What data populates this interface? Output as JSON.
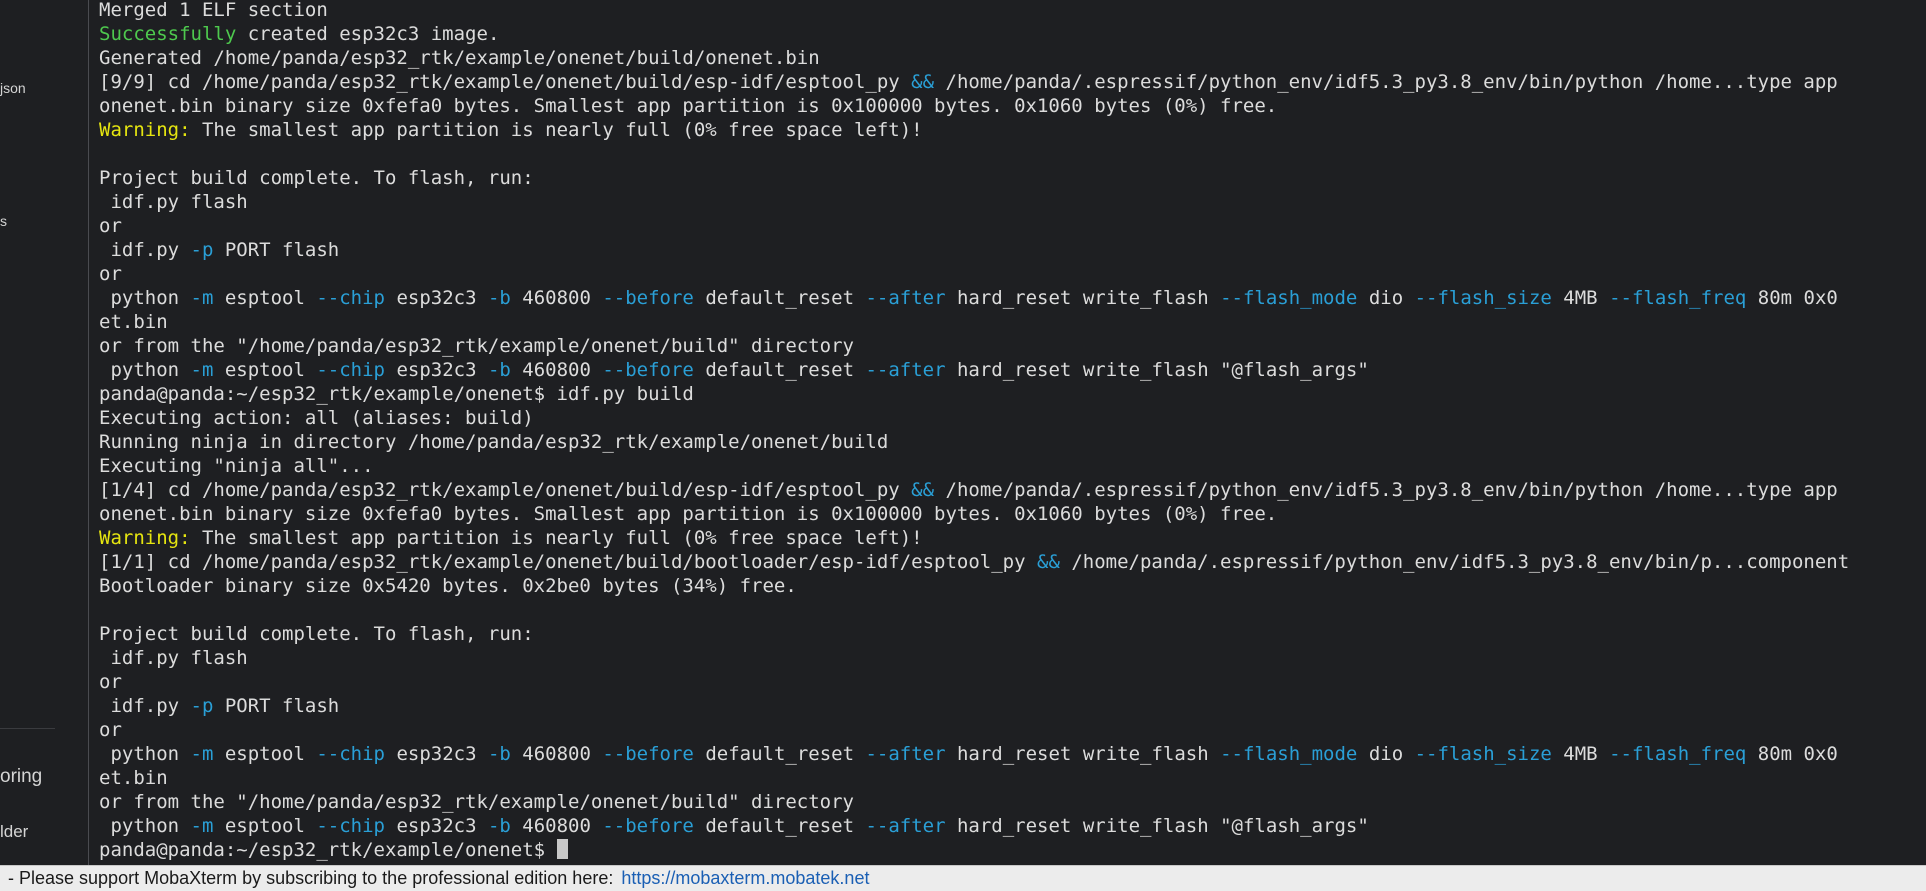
{
  "sidebar": {
    "items": [
      {
        "label": "json"
      },
      {
        "label": "s"
      },
      {
        "label": "oring"
      },
      {
        "label": "lder"
      }
    ]
  },
  "terminal": {
    "lines": [
      [
        {
          "t": "Merged 1 ELF section"
        }
      ],
      [
        {
          "t": "Successfully",
          "c": "green"
        },
        {
          "t": " created esp32c3 image."
        }
      ],
      [
        {
          "t": "Generated /home/panda/esp32_rtk/example/onenet/build/onenet.bin"
        }
      ],
      [
        {
          "t": "[9/9] cd /home/panda/esp32_rtk/example/onenet/build/esp-idf/esptool_py "
        },
        {
          "t": "&&",
          "c": "blue"
        },
        {
          "t": " /home/panda/.espressif/python_env/idf5.3_py3.8_env/bin/python /home...type app"
        }
      ],
      [
        {
          "t": "onenet.bin binary size 0xfefa0 bytes. Smallest app partition is 0x100000 bytes. 0x1060 bytes (0%) free."
        }
      ],
      [
        {
          "t": "Warning:",
          "c": "yellow"
        },
        {
          "t": " The smallest app partition is nearly full (0% free space left)!"
        }
      ],
      [
        {
          "t": ""
        }
      ],
      [
        {
          "t": "Project build complete. To flash, run:"
        }
      ],
      [
        {
          "t": " idf.py flash"
        }
      ],
      [
        {
          "t": "or"
        }
      ],
      [
        {
          "t": " idf.py "
        },
        {
          "t": "-p",
          "c": "blue"
        },
        {
          "t": " PORT flash"
        }
      ],
      [
        {
          "t": "or"
        }
      ],
      [
        {
          "t": " python "
        },
        {
          "t": "-m",
          "c": "blue"
        },
        {
          "t": " esptool "
        },
        {
          "t": "--chip",
          "c": "blue"
        },
        {
          "t": " esp32c3 "
        },
        {
          "t": "-b",
          "c": "blue"
        },
        {
          "t": " 460800 "
        },
        {
          "t": "--before",
          "c": "blue"
        },
        {
          "t": " default_reset "
        },
        {
          "t": "--after",
          "c": "blue"
        },
        {
          "t": " hard_reset write_flash "
        },
        {
          "t": "--flash_mode",
          "c": "blue"
        },
        {
          "t": " dio "
        },
        {
          "t": "--flash_size",
          "c": "blue"
        },
        {
          "t": " 4MB "
        },
        {
          "t": "--flash_freq",
          "c": "blue"
        },
        {
          "t": " 80m 0x0"
        }
      ],
      [
        {
          "t": "et.bin"
        }
      ],
      [
        {
          "t": "or from the \"/home/panda/esp32_rtk/example/onenet/build\" directory"
        }
      ],
      [
        {
          "t": " python "
        },
        {
          "t": "-m",
          "c": "blue"
        },
        {
          "t": " esptool "
        },
        {
          "t": "--chip",
          "c": "blue"
        },
        {
          "t": " esp32c3 "
        },
        {
          "t": "-b",
          "c": "blue"
        },
        {
          "t": " 460800 "
        },
        {
          "t": "--before",
          "c": "blue"
        },
        {
          "t": " default_reset "
        },
        {
          "t": "--after",
          "c": "blue"
        },
        {
          "t": " hard_reset write_flash \"@flash_args\""
        }
      ],
      [
        {
          "t": "panda@panda:~/esp32_rtk/example/onenet$ idf.py build"
        }
      ],
      [
        {
          "t": "Executing action: all (aliases: build)"
        }
      ],
      [
        {
          "t": "Running ninja in directory /home/panda/esp32_rtk/example/onenet/build"
        }
      ],
      [
        {
          "t": "Executing \"ninja all\"..."
        }
      ],
      [
        {
          "t": "[1/4] cd /home/panda/esp32_rtk/example/onenet/build/esp-idf/esptool_py "
        },
        {
          "t": "&&",
          "c": "blue"
        },
        {
          "t": " /home/panda/.espressif/python_env/idf5.3_py3.8_env/bin/python /home...type app"
        }
      ],
      [
        {
          "t": "onenet.bin binary size 0xfefa0 bytes. Smallest app partition is 0x100000 bytes. 0x1060 bytes (0%) free."
        }
      ],
      [
        {
          "t": "Warning:",
          "c": "yellow"
        },
        {
          "t": " The smallest app partition is nearly full (0% free space left)!"
        }
      ],
      [
        {
          "t": "[1/1] cd /home/panda/esp32_rtk/example/onenet/build/bootloader/esp-idf/esptool_py "
        },
        {
          "t": "&&",
          "c": "blue"
        },
        {
          "t": " /home/panda/.espressif/python_env/idf5.3_py3.8_env/bin/p...component"
        }
      ],
      [
        {
          "t": "Bootloader binary size 0x5420 bytes. 0x2be0 bytes (34%) free."
        }
      ],
      [
        {
          "t": ""
        }
      ],
      [
        {
          "t": "Project build complete. To flash, run:"
        }
      ],
      [
        {
          "t": " idf.py flash"
        }
      ],
      [
        {
          "t": "or"
        }
      ],
      [
        {
          "t": " idf.py "
        },
        {
          "t": "-p",
          "c": "blue"
        },
        {
          "t": " PORT flash"
        }
      ],
      [
        {
          "t": "or"
        }
      ],
      [
        {
          "t": " python "
        },
        {
          "t": "-m",
          "c": "blue"
        },
        {
          "t": " esptool "
        },
        {
          "t": "--chip",
          "c": "blue"
        },
        {
          "t": " esp32c3 "
        },
        {
          "t": "-b",
          "c": "blue"
        },
        {
          "t": " 460800 "
        },
        {
          "t": "--before",
          "c": "blue"
        },
        {
          "t": " default_reset "
        },
        {
          "t": "--after",
          "c": "blue"
        },
        {
          "t": " hard_reset write_flash "
        },
        {
          "t": "--flash_mode",
          "c": "blue"
        },
        {
          "t": " dio "
        },
        {
          "t": "--flash_size",
          "c": "blue"
        },
        {
          "t": " 4MB "
        },
        {
          "t": "--flash_freq",
          "c": "blue"
        },
        {
          "t": " 80m 0x0"
        }
      ],
      [
        {
          "t": "et.bin"
        }
      ],
      [
        {
          "t": "or from the \"/home/panda/esp32_rtk/example/onenet/build\" directory"
        }
      ],
      [
        {
          "t": " python "
        },
        {
          "t": "-m",
          "c": "blue"
        },
        {
          "t": " esptool "
        },
        {
          "t": "--chip",
          "c": "blue"
        },
        {
          "t": " esp32c3 "
        },
        {
          "t": "-b",
          "c": "blue"
        },
        {
          "t": " 460800 "
        },
        {
          "t": "--before",
          "c": "blue"
        },
        {
          "t": " default_reset "
        },
        {
          "t": "--after",
          "c": "blue"
        },
        {
          "t": " hard_reset write_flash \"@flash_args\""
        }
      ],
      [
        {
          "t": "panda@panda:~/esp32_rtk/example/onenet$ "
        }
      ]
    ]
  },
  "status_bar": {
    "message": " -  Please support MobaXterm by subscribing to the professional edition here:",
    "link": "https://mobaxterm.mobatek.net"
  },
  "colors": {
    "background": "#1e1f22",
    "text": "#dcdcdc",
    "green": "#4ec94e",
    "yellow": "#e5e510",
    "blue": "#2a9fd6",
    "status_bar": "#ececec",
    "link": "#1a5fb4"
  }
}
